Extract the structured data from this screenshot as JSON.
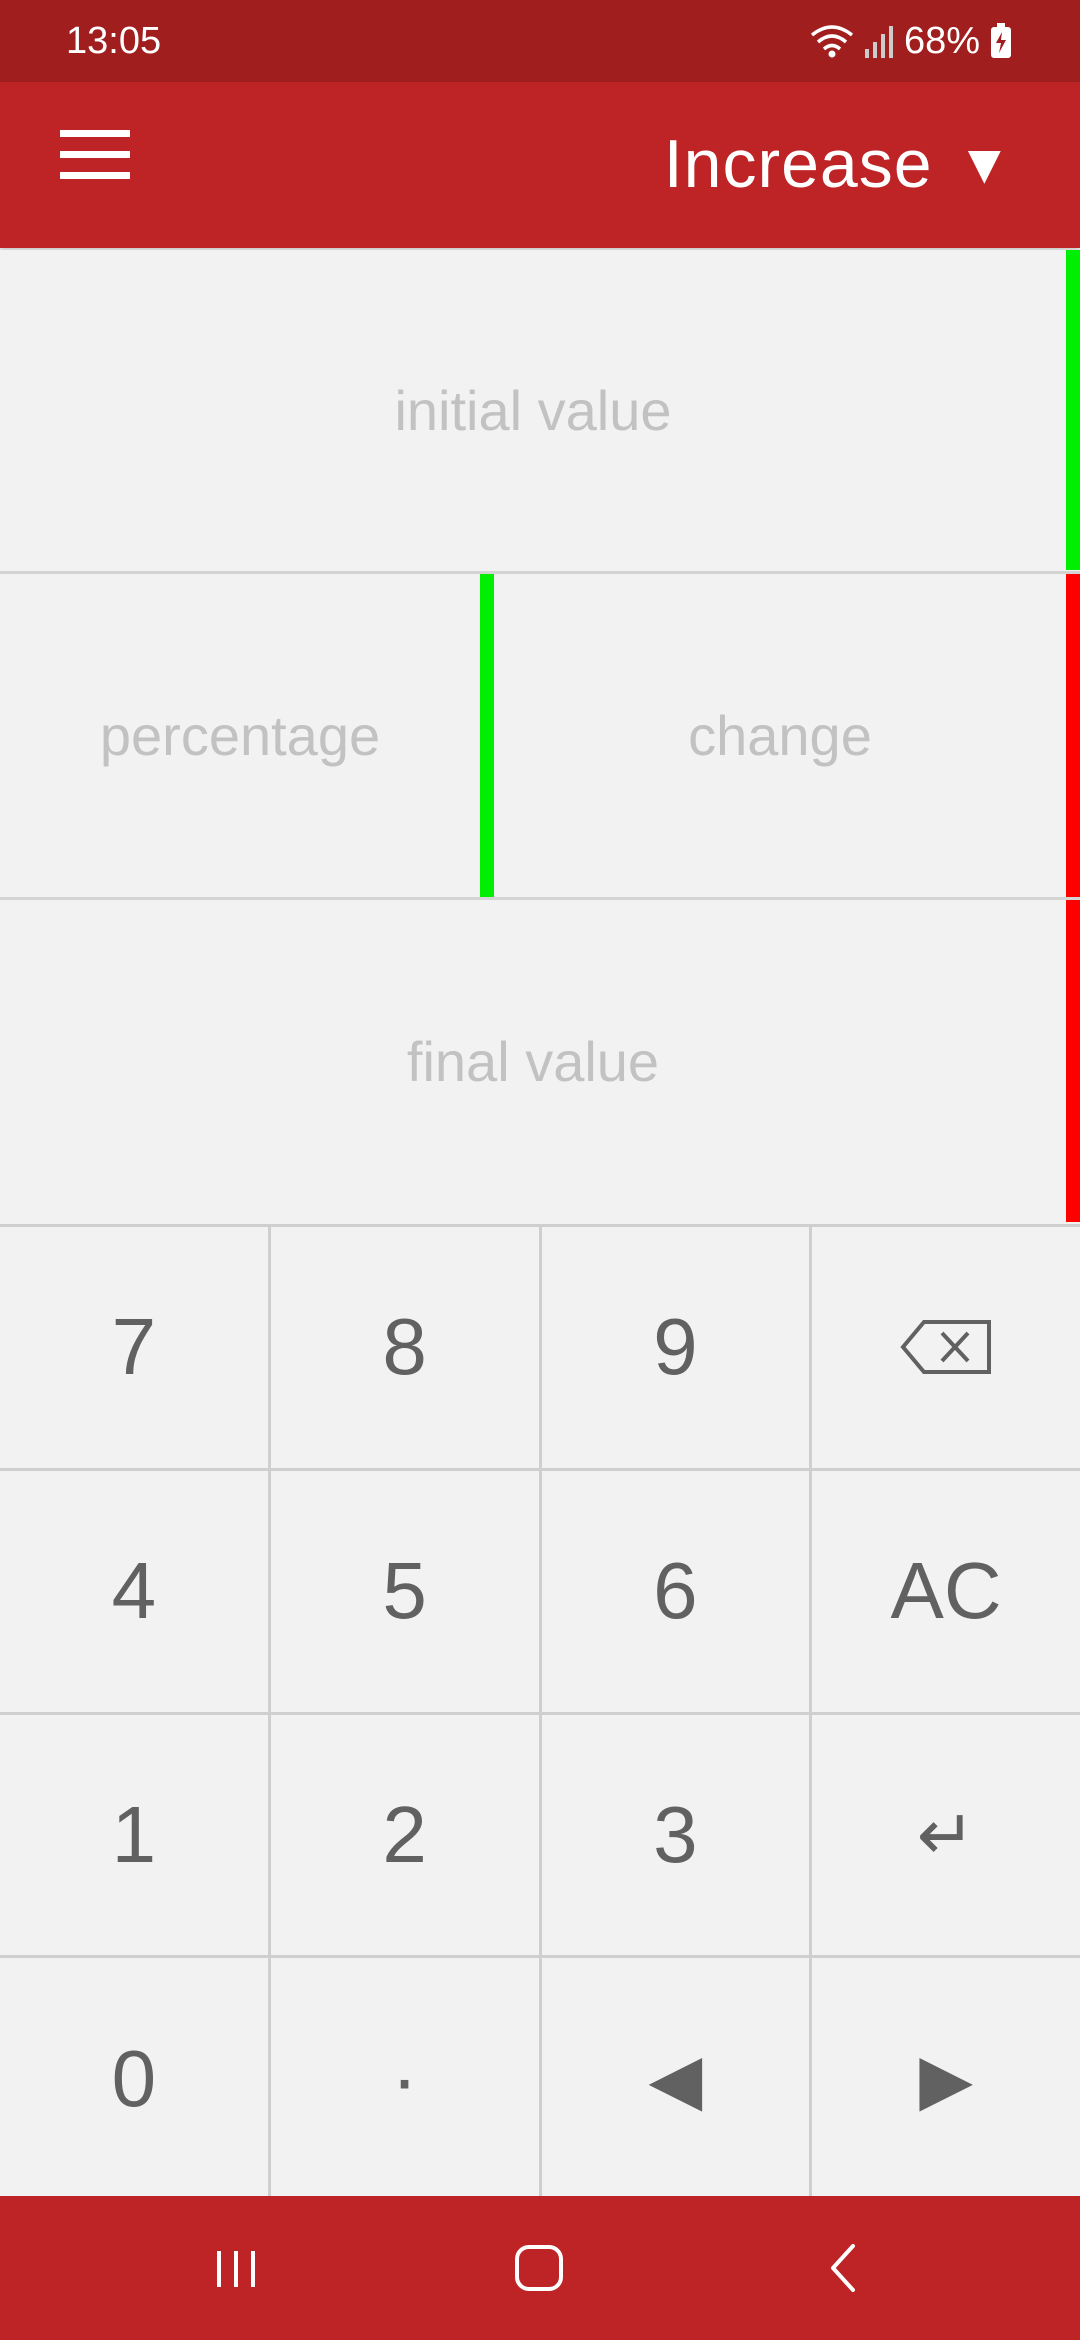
{
  "status": {
    "time": "13:05",
    "battery": "68%",
    "icons": [
      "wifi-icon",
      "signal-icon",
      "battery-charging-icon"
    ]
  },
  "app_bar": {
    "mode": "Increase",
    "mode_arrow": "▼",
    "menu_icon": "menu-icon",
    "background": "#be2325"
  },
  "fields": {
    "initial_placeholder": "initial value",
    "percentage_placeholder": "percentage",
    "change_placeholder": "change",
    "final_placeholder": "final value"
  },
  "indicator_colors": {
    "valid": "#00ee00",
    "invalid": "#ff0000"
  },
  "keypad": {
    "k7": "7",
    "k8": "8",
    "k9": "9",
    "backspace_icon": "backspace-icon",
    "k4": "4",
    "k5": "5",
    "k6": "6",
    "clear": "AC",
    "k1": "1",
    "k2": "2",
    "k3": "3",
    "enter": "↵",
    "k0": "0",
    "decimal": "·",
    "left": "◀",
    "right": "▶"
  },
  "nav": {
    "icons": [
      "recent-apps-icon",
      "home-icon",
      "back-icon"
    ]
  }
}
